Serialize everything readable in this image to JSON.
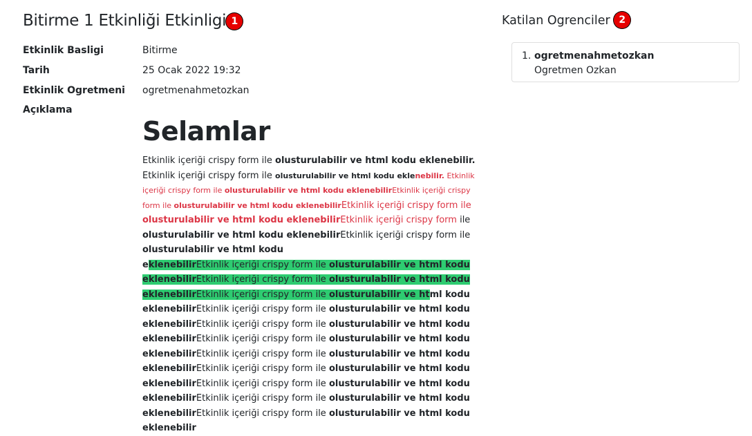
{
  "event": {
    "title": "Bitirme 1 Etkinliği Etkinligi",
    "title_badge": "1",
    "details": [
      {
        "label": "Etkinlik Basligi",
        "value": "Bitirme"
      },
      {
        "label": "Tarih",
        "value": "25 Ocak 2022 19:32"
      },
      {
        "label": "Etkinlik Ogretmeni",
        "value": "ogretmenahmetozkan"
      },
      {
        "label": "Açıklama",
        "value": ""
      }
    ],
    "description": {
      "heading": "Selamlar",
      "intro_text": "Etkinlik içeriği crispy form ile",
      "intro_bold": "olusturulabilir ve html kodu eklenebilir.",
      "repeat_text": "Etkinlik içeriği crispy form ile",
      "repeat_bold": "olusturulabilir ve html kodu eklenebilir",
      "small_bold_a": "olusturulabilir ve html kodu ekle",
      "small_bold_b": "nebilir.",
      "cut_a": "Etkinlik içeriği crispy form",
      "cut_b": "ile",
      "frag_e": "e",
      "frag_klenebilir": "klenebilir",
      "frag_html_kodu": "olusturulabilir ve html kodu",
      "frag_eklenebilir": "eklenebilir",
      "frag_ht": "olusturulabilir ve ht",
      "frag_ml_kodu": "ml kodu"
    }
  },
  "participants": {
    "title": "Katilan Ogrenciler",
    "badge": "2",
    "items": [
      {
        "number": "1.",
        "username": "ogretmenahmetozkan",
        "full_name": "Ogretmen Ozkan"
      }
    ]
  },
  "colors": {
    "badge": "#e60000",
    "highlight": "#2ecc71",
    "red_text": "#dc3545",
    "card_border": "#dfdfdf"
  }
}
